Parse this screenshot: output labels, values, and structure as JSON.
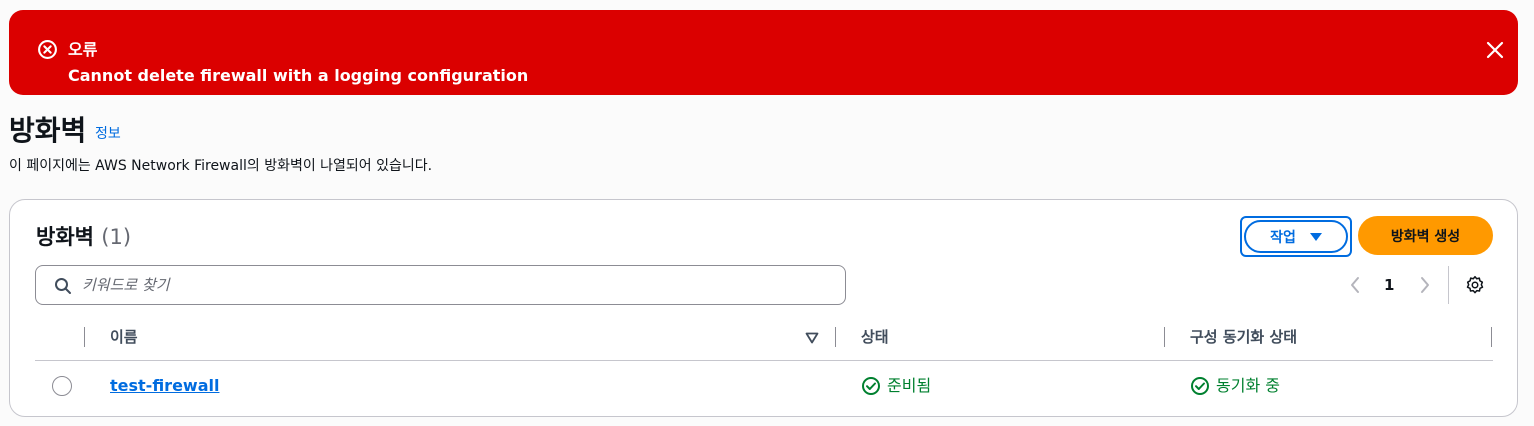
{
  "flash": {
    "type": "error",
    "title": "오류",
    "message": "Cannot delete firewall with a logging configuration",
    "icon": "error-circle-icon",
    "close_icon": "close-icon",
    "color": "#db0000"
  },
  "header": {
    "title": "방화벽",
    "info_link": "정보",
    "description": "이 페이지에는 AWS Network Firewall의 방화벽이 나열되어 있습니다."
  },
  "table_panel": {
    "title": "방화벽",
    "count": "(1)",
    "actions_label": "작업",
    "create_label": "방화벽 생성",
    "search_placeholder": "키워드로 찾기",
    "page_number": "1",
    "columns": [
      "이름",
      "상태",
      "구성 동기화 상태"
    ],
    "rows": [
      {
        "name": "test-firewall",
        "status": "준비됨",
        "sync_status": "동기화 중"
      }
    ]
  },
  "colors": {
    "accent": "#006ce0",
    "primary_button": "#ff9900",
    "success": "#00802f",
    "error": "#db0000"
  }
}
